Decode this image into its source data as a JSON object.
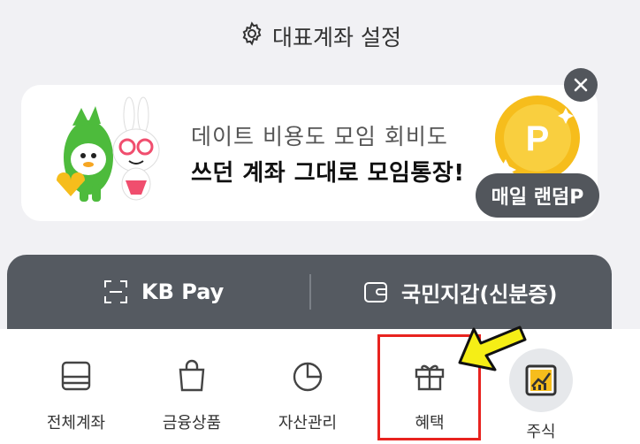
{
  "rep_account": {
    "label": "대표계좌 설정",
    "icon": "gear-icon"
  },
  "banner": {
    "line1": "데이트 비용도 모임 회비도",
    "line2": "쓰던 계좌 그대로 모임통장!",
    "badge": "매일 랜덤P",
    "coin_letter": "P",
    "close_icon": "close-icon"
  },
  "quickbar": {
    "pay_label": "KB Pay",
    "wallet_label": "국민지갑(신분증)"
  },
  "tabs": [
    {
      "label": "전체계좌",
      "icon": "account-icon"
    },
    {
      "label": "금융상품",
      "icon": "bag-icon"
    },
    {
      "label": "자산관리",
      "icon": "pie-chart-icon"
    },
    {
      "label": "혜택",
      "icon": "gift-icon"
    },
    {
      "label": "주식",
      "icon": "stock-chart-icon"
    }
  ],
  "colors": {
    "dark_bar": "#555a61",
    "highlight": "#e8231f",
    "arrow": "#f5ee16",
    "coin": "#f6bd1c"
  }
}
